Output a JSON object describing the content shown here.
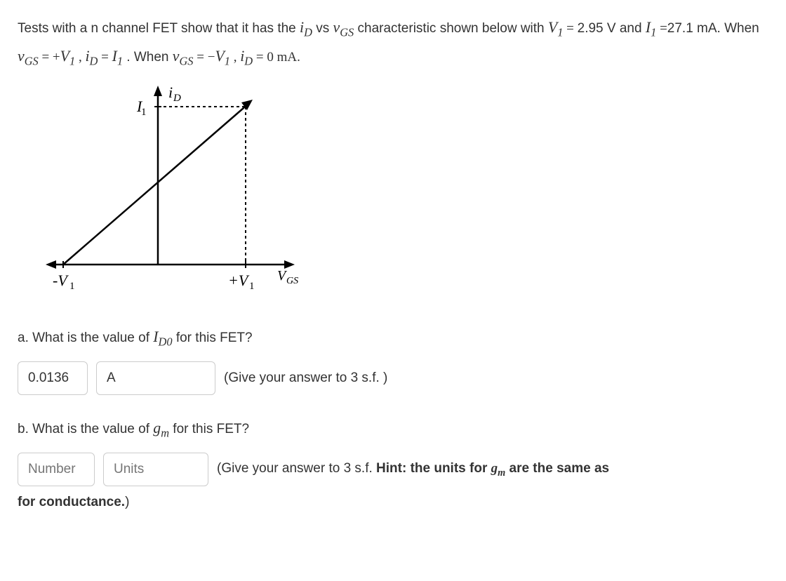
{
  "problem": {
    "line1_part1": "Tests with a n channel FET show that it has the ",
    "line1_iD": "i",
    "line1_D": "D",
    "line1_vs": " vs ",
    "line1_vGS": "v",
    "line1_GS": "GS",
    "line1_part2": "  characteristic shown below with ",
    "line1_V1": "V",
    "line1_1": "1",
    "line1_equals": " = ",
    "line2_val1": "2.95 V and ",
    "line2_I1": "I",
    "line2_1": "1",
    "line2_eq1": " =",
    "line2_val2": "27.1 mA. When ",
    "line2_vGS2": "v",
    "line2_GS2": "GS",
    "line2_eq2": " = +",
    "line2_V1b": "V",
    "line2_1b": "1",
    "line2_comma": " , ",
    "line2_iD2": "i",
    "line2_D2": "D",
    "line2_eq3": " = ",
    "line2_I1b": "I",
    "line2_1b2": "1",
    "line2_period": " . When ",
    "line2_vGS3": "v",
    "line2_GS3": "GS",
    "line2_eq4": " = −",
    "line2_V1c": "V",
    "line2_1c": "1",
    "line2_comma2": " , ",
    "line2_iD3": "i",
    "line2_D3": "D",
    "line2_eq5": " = 0 mA."
  },
  "graph": {
    "y_label": "i",
    "y_sub": "D",
    "i1_label": "I",
    "i1_sub": "1",
    "neg_v1": "-V",
    "neg_v1_sub": "1",
    "pos_v1": "+V",
    "pos_v1_sub": "1",
    "x_label": "V",
    "x_sub": "GS"
  },
  "question_a": {
    "prefix": "a. What is the value of ",
    "var": "I",
    "sub": "D0",
    "suffix": "  for this FET?",
    "value": "0.0136",
    "unit": "A",
    "hint": "(Give your answer to 3 s.f. )"
  },
  "question_b": {
    "prefix": "b. What is the value of ",
    "var": "g",
    "sub": "m",
    "suffix": "  for this FET?",
    "value_placeholder": "Number",
    "unit_placeholder": "Units",
    "hint1": "(Give your answer to 3 s.f. ",
    "hint2": "Hint: the units for ",
    "hint_var": "g",
    "hint_sub": "m",
    "hint3": "  are the same as",
    "hint4": "for conductance."
  }
}
